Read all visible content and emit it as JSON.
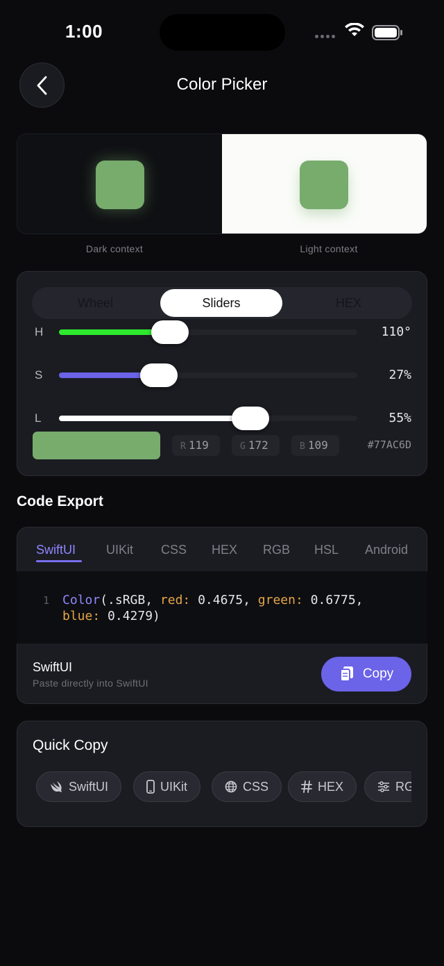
{
  "status_bar": {
    "time": "1:00"
  },
  "header": {
    "title": "Color Picker"
  },
  "preview": {
    "color": "#77AC6D",
    "dark_label": "Dark context",
    "light_label": "Light context"
  },
  "picker": {
    "modes": [
      "Wheel",
      "Sliders",
      "HEX"
    ],
    "active_mode": "Sliders",
    "sliders": [
      {
        "label": "H",
        "value": "110°",
        "fraction": 0.305,
        "color": "#2ee82e"
      },
      {
        "label": "S",
        "value": "27%",
        "fraction": 0.27,
        "color": "#6b63e8"
      },
      {
        "label": "L",
        "value": "55%",
        "fraction": 0.55,
        "color": "#ffffff"
      }
    ],
    "rgb": {
      "r_label": "R",
      "r": "119",
      "g_label": "G",
      "g": "172",
      "b_label": "B",
      "b": "109"
    },
    "hex": "#77AC6D"
  },
  "code_export": {
    "title": "Code Export",
    "tabs": [
      "SwiftUI",
      "UIKit",
      "CSS",
      "HEX",
      "RGB",
      "HSL",
      "Android"
    ],
    "active_tab": "SwiftUI",
    "line_number": "1",
    "code": {
      "type": "Color",
      "open": "(.sRGB, ",
      "red_key": "red:",
      "red_val": " 0.4675, ",
      "green_key": "green:",
      "green_val": " 0.6775,",
      "blue_key": "blue:",
      "blue_val": " 0.4279)"
    },
    "format_name": "SwiftUI",
    "format_hint": "Paste directly into SwiftUI",
    "copy_label": "Copy"
  },
  "quick_copy": {
    "title": "Quick Copy",
    "items": [
      {
        "label": "SwiftUI",
        "icon": "swift-icon"
      },
      {
        "label": "UIKit",
        "icon": "phone-icon"
      },
      {
        "label": "CSS",
        "icon": "globe-icon"
      },
      {
        "label": "HEX",
        "icon": "hash-icon"
      },
      {
        "label": "RG",
        "icon": "sliders-icon"
      }
    ]
  }
}
